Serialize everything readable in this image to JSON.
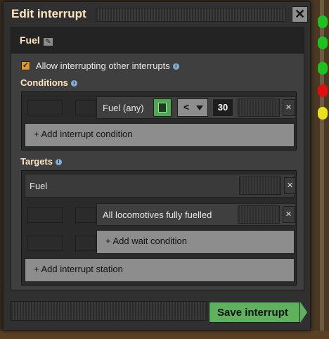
{
  "window": {
    "title": "Edit interrupt",
    "close_label": "✕"
  },
  "interrupt": {
    "name": "Fuel",
    "allow_interrupting_label": "Allow interrupting other interrupts",
    "allow_interrupting_checked": true
  },
  "conditions": {
    "label": "Conditions",
    "items": [
      {
        "label": "Fuel (any)",
        "comparator": "<",
        "value": "30"
      }
    ],
    "add_label": "+ Add interrupt condition"
  },
  "targets": {
    "label": "Targets",
    "station": "Fuel",
    "wait_conditions": [
      {
        "label": "All locomotives fully fuelled"
      }
    ],
    "add_wait_label": "+ Add wait condition",
    "add_station_label": "+ Add interrupt station"
  },
  "footer": {
    "save_label": "Save interrupt"
  },
  "colors": {
    "accent_green": "#5eb25e",
    "checkbox_orange": "#e09a30",
    "heading": "#ffe6c0"
  }
}
